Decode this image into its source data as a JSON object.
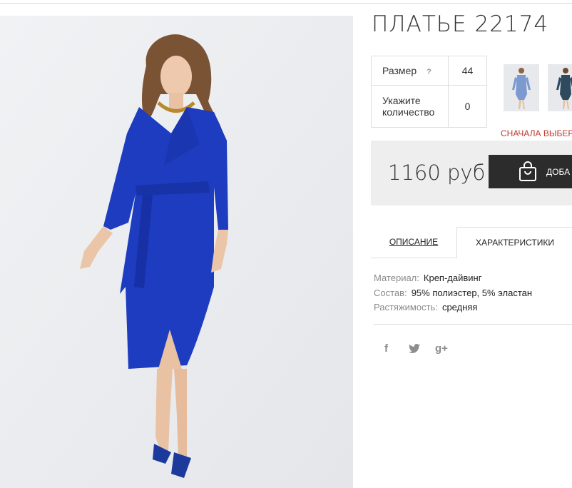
{
  "product": {
    "title": "ПЛАТЬЕ 22174",
    "options": {
      "size_label": "Размер",
      "size_help": "?",
      "size_value": "44",
      "qty_label": "Укажите количество",
      "qty_value": "0"
    },
    "warning": "СНАЧАЛА ВЫБЕР",
    "price": "1160 руб",
    "add_to_cart_label": "ДОБА"
  },
  "tabs": [
    {
      "label": "ОПИСАНИЕ"
    },
    {
      "label": "ХАРАКТЕРИСТИКИ"
    }
  ],
  "specs": [
    {
      "key": "Материал:",
      "value": "Креп-дайвинг"
    },
    {
      "key": "Состав:",
      "value": "95% полиэстер, 5% эластан"
    },
    {
      "key": "Растяжимость:",
      "value": "средняя"
    }
  ],
  "social": {
    "facebook": "f",
    "twitter": "twitter-bird",
    "googleplus": "g+"
  },
  "colors": {
    "dress_blue": "#1d3cc0",
    "thumb_light_blue": "#7d9ad0",
    "thumb_dark": "#2f4a5e",
    "warning_red": "#c0392b",
    "button_dark": "#2c2c2c"
  }
}
